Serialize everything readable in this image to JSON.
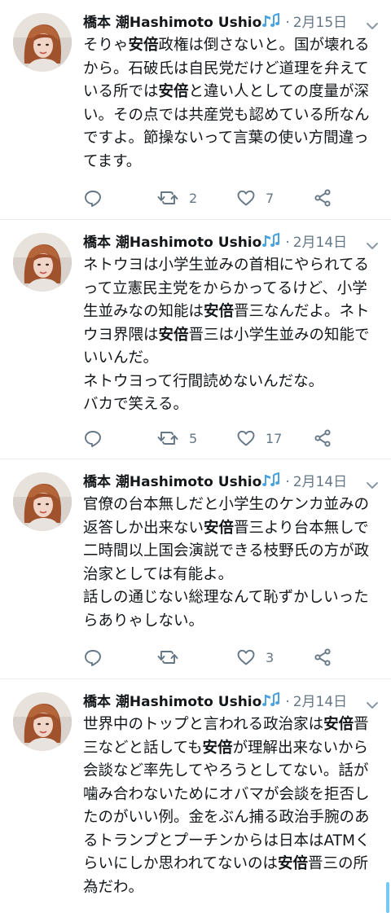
{
  "tweets": [
    {
      "name": "橋本 潮Hashimoto Ushio",
      "dot": "·",
      "date": "2月15日",
      "body": [
        {
          "t": "そりゃ"
        },
        {
          "t": "安倍",
          "b": true
        },
        {
          "t": "政権は倒さないと。国が壊れるから。石破氏は自民党だけど道理を弁えている所では"
        },
        {
          "t": "安倍",
          "b": true
        },
        {
          "t": "と違い人としての度量が深い。その点では共産党も認めている所なんですよ。節操ないって言葉の使い方間違ってます。"
        }
      ],
      "reply_count": "",
      "retweet_count": "2",
      "like_count": "7"
    },
    {
      "name": "橋本 潮Hashimoto Ushio",
      "dot": "·",
      "date": "2月14日",
      "body": [
        {
          "t": "ネトウヨは小学生並みの首相にやられてるって立憲民主党をからかってるけど、小学生並みなの知能は"
        },
        {
          "t": "安倍",
          "b": true
        },
        {
          "t": "晋三なんだよ。ネトウヨ界隈は"
        },
        {
          "t": "安倍",
          "b": true
        },
        {
          "t": "晋三は小学生並みの知能でいいんだ。\nネトウヨって行間読めないんだな。\nバカで笑える。"
        }
      ],
      "reply_count": "",
      "retweet_count": "5",
      "like_count": "17"
    },
    {
      "name": "橋本 潮Hashimoto Ushio",
      "dot": "·",
      "date": "2月14日",
      "body": [
        {
          "t": "官僚の台本無しだと小学生のケンカ並みの返答しか出来ない"
        },
        {
          "t": "安倍",
          "b": true
        },
        {
          "t": "晋三より台本無しで二時間以上国会演説できる枝野氏の方が政治家としては有能よ。\n話しの通じない総理なんて恥ずかしいったらありゃしない。"
        }
      ],
      "reply_count": "",
      "retweet_count": "",
      "like_count": "3"
    },
    {
      "name": "橋本 潮Hashimoto Ushio",
      "dot": "·",
      "date": "2月14日",
      "body": [
        {
          "t": "世界中のトップと言われる政治家は"
        },
        {
          "t": "安倍",
          "b": true
        },
        {
          "t": "晋三などと話しても"
        },
        {
          "t": "安倍",
          "b": true
        },
        {
          "t": "が理解出来ないから会談など率先してやろうとしてない。話が噛み合わないためにオバマが会談を拒否したのがいい例。金をぶん捕る政治手腕のあるトランプとプーチンからは日本はATMくらいにしか思われてないのは"
        },
        {
          "t": "安倍",
          "b": true
        },
        {
          "t": "晋三の所為だわ。"
        }
      ],
      "reply_count": "",
      "retweet_count": "",
      "like_count": ""
    }
  ],
  "icons": {
    "note": "musical-notes-icon",
    "chevron": "chevron-down-icon",
    "reply": "reply-icon",
    "retweet": "retweet-icon",
    "like": "heart-icon",
    "share": "share-icon"
  },
  "colors": {
    "text": "#14171a",
    "secondary": "#657786",
    "note_blue": "#4aa3df",
    "divider": "#e6ecf0"
  }
}
